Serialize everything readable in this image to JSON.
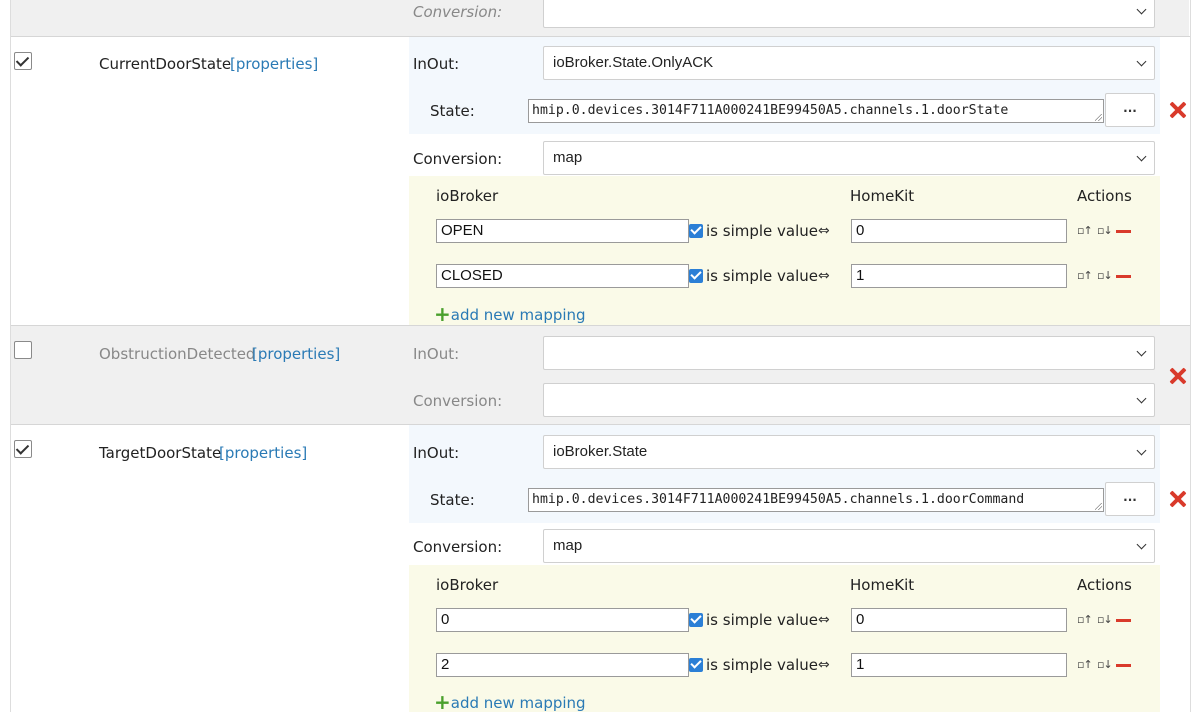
{
  "top_row": {
    "conversion_label": "Conversion:",
    "conversion_value": ""
  },
  "characteristics": [
    {
      "checked": true,
      "name": "CurrentDoorState",
      "props_link": "[properties]",
      "inout_label": "InOut:",
      "inout_value": "ioBroker.State.OnlyACK",
      "state_label": "State:",
      "state_value": "hmip.0.devices.3014F711A000241BE99450A5.channels.1.doorState",
      "dots_label": "...",
      "conversion_label": "Conversion:",
      "conversion_value": "map",
      "mapping": {
        "col_iobroker": "ioBroker",
        "col_homekit": "HomeKit",
        "col_actions": "Actions",
        "rows": [
          {
            "iobroker": "OPEN",
            "simple_label": "is simple value",
            "arrow": "⇔",
            "homekit": "0"
          },
          {
            "iobroker": "CLOSED",
            "simple_label": "is simple value",
            "arrow": "⇔",
            "homekit": "1"
          }
        ],
        "add_label": "add new mapping",
        "add_icon": "+"
      }
    },
    {
      "checked": false,
      "name": "ObstructionDetected",
      "props_link": "[properties]",
      "inout_label": "InOut:",
      "inout_value": "",
      "conversion_label": "Conversion:",
      "conversion_value": ""
    },
    {
      "checked": true,
      "name": "TargetDoorState",
      "props_link": "[properties]",
      "inout_label": "InOut:",
      "inout_value": "ioBroker.State",
      "state_label": "State:",
      "state_value": "hmip.0.devices.3014F711A000241BE99450A5.channels.1.doorCommand",
      "dots_label": "...",
      "conversion_label": "Conversion:",
      "conversion_value": "map",
      "mapping": {
        "col_iobroker": "ioBroker",
        "col_homekit": "HomeKit",
        "col_actions": "Actions",
        "rows": [
          {
            "iobroker": "0",
            "simple_label": "is simple value",
            "arrow": "⇔",
            "homekit": "0"
          },
          {
            "iobroker": "2",
            "simple_label": "is simple value",
            "arrow": "⇔",
            "homekit": "1"
          }
        ],
        "add_label": "add new mapping",
        "add_icon": "+"
      }
    }
  ],
  "icons": {
    "sort_up": "▫↑",
    "sort_down": "▫↓",
    "remove_icon": "x",
    "delete_icon": "minus"
  },
  "colors": {
    "accent_link": "#2a7ab5",
    "delete_red": "#d93a2b",
    "add_green": "#4aa02c",
    "checkbox_blue": "#2b7fd6"
  }
}
